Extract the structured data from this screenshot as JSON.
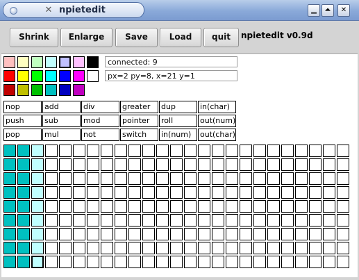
{
  "window": {
    "title": "npietedit",
    "app_icon": "npietedit-tools-icon",
    "minimize_glyph": "▁",
    "maximize_glyph": "⏶",
    "close_glyph": "✕"
  },
  "toolbar": {
    "shrink_label": "Shrink",
    "enlarge_label": "Enlarge",
    "save_label": "Save",
    "load_label": "Load",
    "quit_label": "quit",
    "version_label": "npietedit v0.9d"
  },
  "palette": {
    "rows": [
      [
        "#ffc0c0",
        "#ffffc0",
        "#c0ffc0",
        "#c0ffff",
        "#c0c0ff",
        "#ffc0ff",
        "#000000"
      ],
      [
        "#ff0000",
        "#ffff00",
        "#00ff00",
        "#00ffff",
        "#0000ff",
        "#ff00ff",
        "#ffffff"
      ],
      [
        "#c00000",
        "#c0c000",
        "#00c000",
        "#00c0c0",
        "#0000c0",
        "#c000c0"
      ]
    ],
    "selected": {
      "row": 0,
      "col": 4
    }
  },
  "status": {
    "connected": "connected: 9",
    "position": "px=2 py=8, x=21 y=1"
  },
  "commands": [
    [
      "nop",
      "add",
      "div",
      "greater",
      "dup",
      "in(char)"
    ],
    [
      "push",
      "sub",
      "mod",
      "pointer",
      "roll",
      "out(num)"
    ],
    [
      "pop",
      "mul",
      "not",
      "switch",
      "in(num)",
      "out(char)"
    ]
  ],
  "canvas": {
    "cols": 25,
    "rows": 9,
    "cursor": {
      "col": 2,
      "row": 8
    },
    "filled": [
      {
        "col": 0,
        "color": "#00c0c0"
      },
      {
        "col": 1,
        "color": "#00c0c0"
      },
      {
        "col": 2,
        "color": "#c0ffff"
      }
    ]
  }
}
